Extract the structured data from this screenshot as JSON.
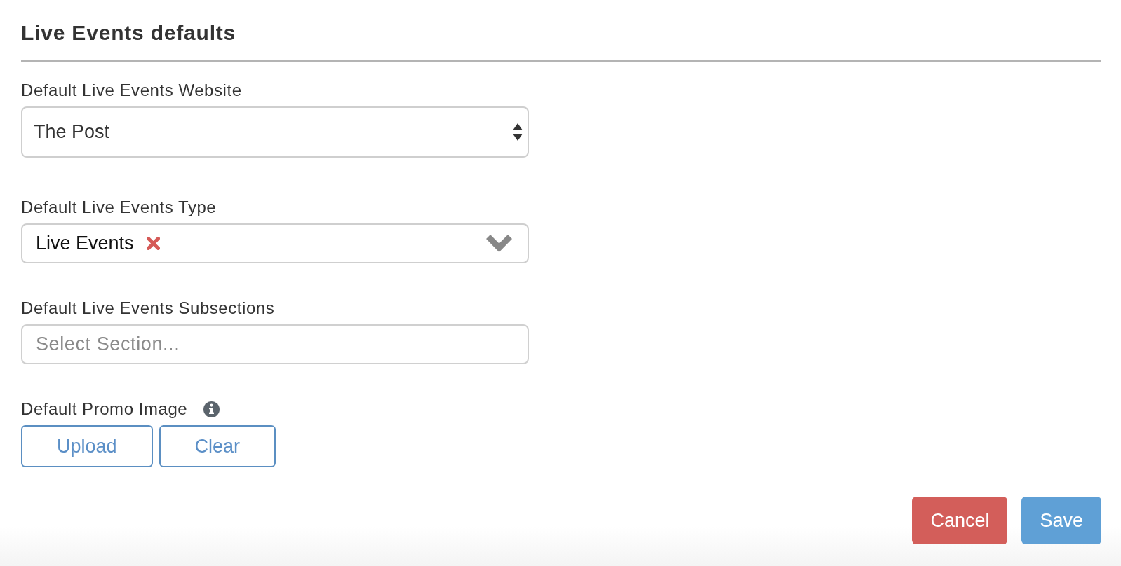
{
  "title": "Live Events defaults",
  "fields": [
    {
      "kind": "select",
      "label": "Default Live Events Website",
      "value": "The Post"
    },
    {
      "kind": "tags",
      "label": "Default Live Events Type",
      "tags": [
        "Live Events"
      ]
    },
    {
      "kind": "input",
      "label": "Default Live Events Subsections",
      "placeholder": "Select Section..."
    }
  ],
  "promo_image": {
    "label": "Default Promo Image",
    "upload_button": "Upload",
    "clear_button": "Clear"
  },
  "actions": {
    "cancel_button": "Cancel",
    "save_button": "Save"
  }
}
